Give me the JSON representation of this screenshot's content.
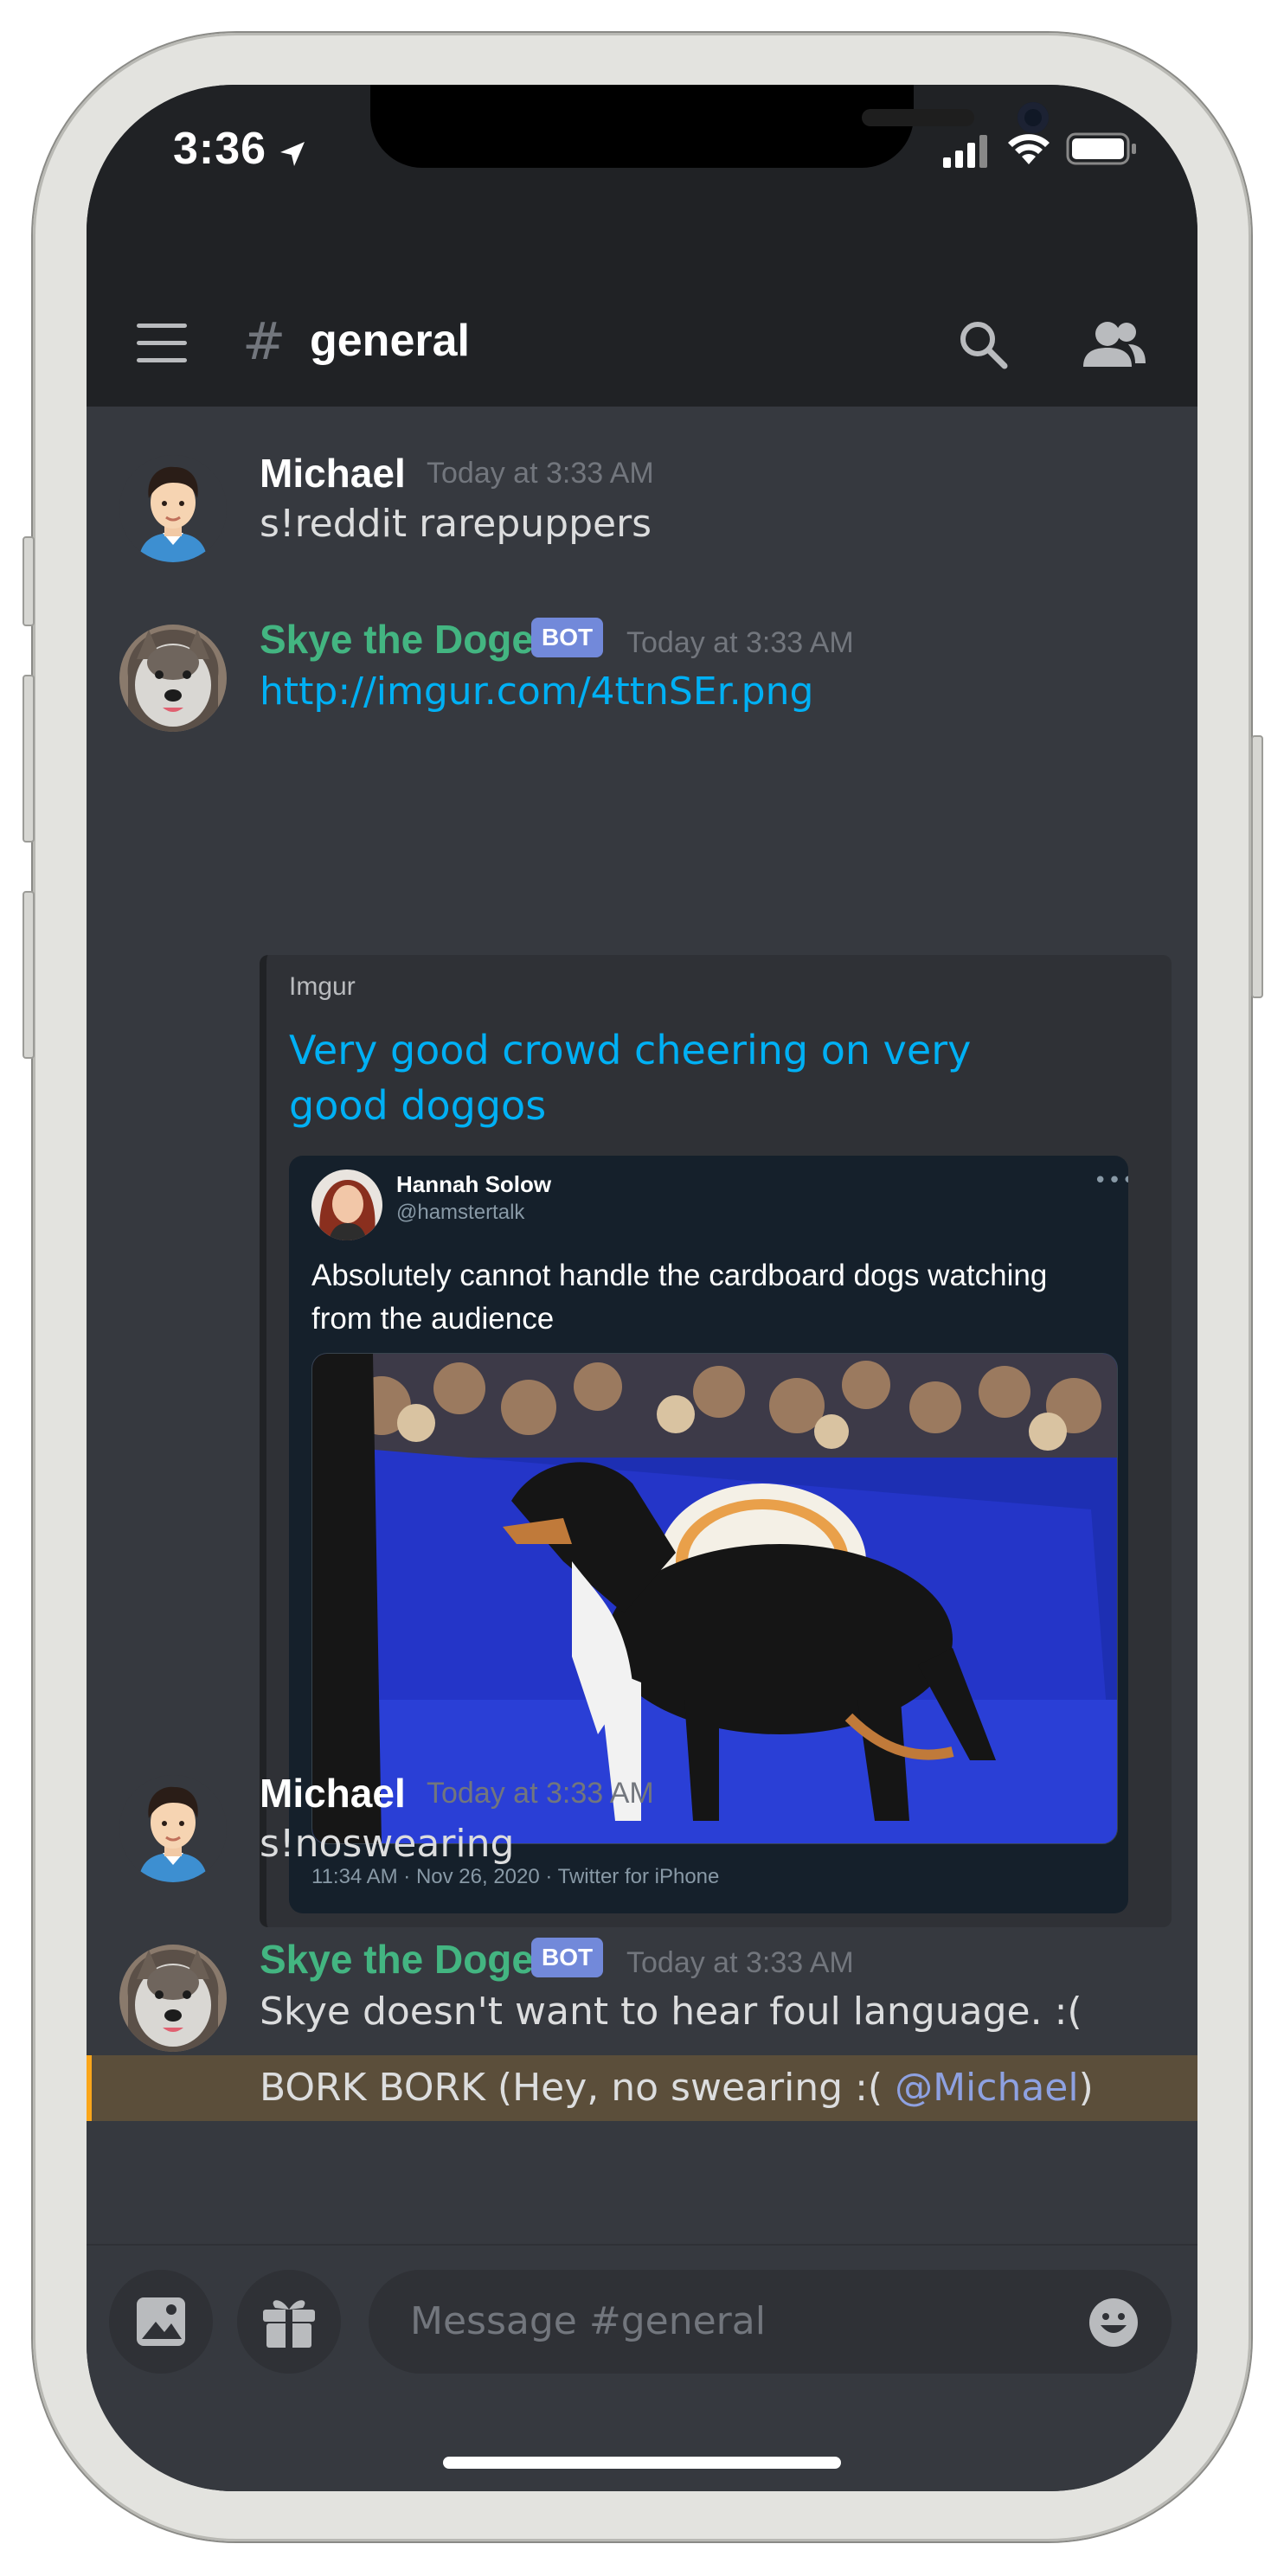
{
  "status_bar": {
    "time": "3:36"
  },
  "header": {
    "hash": "#",
    "channel": "general"
  },
  "messages": [
    {
      "author": "Michael",
      "timestamp": "Today at 3:33 AM",
      "text": "s!reddit rarepuppers"
    },
    {
      "author": "Skye the Doge",
      "badge": "BOT",
      "timestamp": "Today at 3:33 AM",
      "link": "http://imgur.com/4ttnSEr.png"
    },
    {
      "author": "Michael",
      "timestamp": "Today at 3:33 AM",
      "text": "s!noswearing"
    },
    {
      "author": "Skye the Doge",
      "badge": "BOT",
      "timestamp": "Today at 3:33 AM",
      "text": "Skye doesn't want to hear foul language. :(",
      "highlight_prefix": "BORK BORK (Hey, no swearing :( ",
      "mention": "@Michael",
      "highlight_suffix": ")"
    }
  ],
  "embed": {
    "provider": "Imgur",
    "title": "Very good crowd cheering on very good doggos",
    "tweet": {
      "name": "Hannah Solow",
      "handle": "@hamstertalk",
      "more": "•••",
      "text": "Absolutely cannot handle the cardboard dogs watching from the audience",
      "footer": "11:34 AM · Nov 26, 2020 · Twitter for iPhone"
    }
  },
  "composer": {
    "placeholder": "Message #general"
  },
  "colors": {
    "background": "#36393f",
    "header": "#202225",
    "bot_name": "#43b581",
    "bot_badge": "#7289da",
    "link": "#00b0f4",
    "mention_bg": "#5b4e3a",
    "mention_bar": "#faa61a"
  }
}
